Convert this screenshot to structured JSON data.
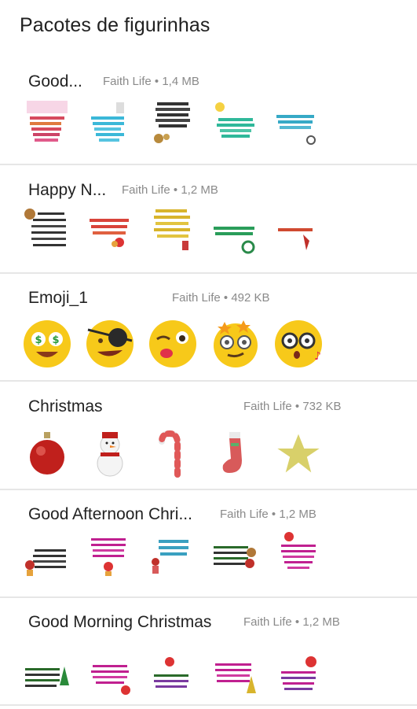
{
  "header": {
    "title": "Pacotes de figurinhas"
  },
  "packs": [
    {
      "name": "Good...",
      "author": "Faith Life",
      "separator": "•",
      "size": "1,4 MB",
      "stickers": [
        "text-card-sticker",
        "text-card-sticker",
        "text-card-sticker",
        "text-card-sticker",
        "text-card-sticker"
      ]
    },
    {
      "name": "Happy N...",
      "author": "Faith Life",
      "separator": "•",
      "size": "1,2 MB",
      "stickers": [
        "text-card-sticker",
        "text-card-sticker",
        "text-card-sticker",
        "text-card-sticker",
        "text-card-sticker"
      ]
    },
    {
      "name": "Emoji_1",
      "author": "Faith Life",
      "separator": "•",
      "size": "492 KB",
      "stickers": [
        "money-eyes-emoji",
        "pirate-eyepatch-emoji",
        "winking-kiss-emoji",
        "dizzy-stars-emoji",
        "glasses-whistling-emoji"
      ]
    },
    {
      "name": "Christmas",
      "author": "Faith Life",
      "separator": "•",
      "size": "732 KB",
      "stickers": [
        "ornament-ball",
        "snowman",
        "candy-cane",
        "christmas-stocking",
        "gold-star"
      ]
    },
    {
      "name": "Good Afternoon Chri...",
      "author": "Faith Life",
      "separator": "•",
      "size": "1,2 MB",
      "stickers": [
        "text-card-sticker",
        "text-card-sticker",
        "text-card-sticker",
        "text-card-sticker",
        "text-card-sticker"
      ]
    },
    {
      "name": "Good Morning Christmas",
      "author": "Faith Life",
      "separator": "•",
      "size": "1,2 MB",
      "stickers": [
        "text-card-sticker",
        "text-card-sticker",
        "text-card-sticker",
        "text-card-sticker",
        "text-card-sticker"
      ]
    }
  ]
}
